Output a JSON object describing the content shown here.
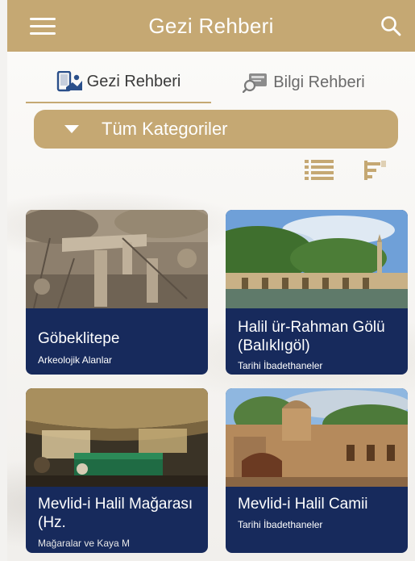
{
  "header": {
    "title": "Gezi Rehberi"
  },
  "tabs": [
    {
      "label": "Gezi Rehberi",
      "active": true
    },
    {
      "label": "Bilgi Rehberi",
      "active": false
    }
  ],
  "filter": {
    "selected": "Tüm Kategoriler"
  },
  "colors": {
    "accent": "#c5a873",
    "card": "#172a5c",
    "tab_icon": "#2a4f8a"
  },
  "places": [
    {
      "name": "Göbeklitepe",
      "category": "Arkeolojik Alanlar"
    },
    {
      "name": "Halil ür-Rahman Gölü (Balıklıgöl)",
      "category": "Tarihi İbadethaneler"
    },
    {
      "name": "Mevlid-i Halil Mağarası (Hz.",
      "category": "Mağaralar ve Kaya M"
    },
    {
      "name": "Mevlid-i Halil Camii",
      "category": "Tarihi İbadethaneler"
    }
  ]
}
